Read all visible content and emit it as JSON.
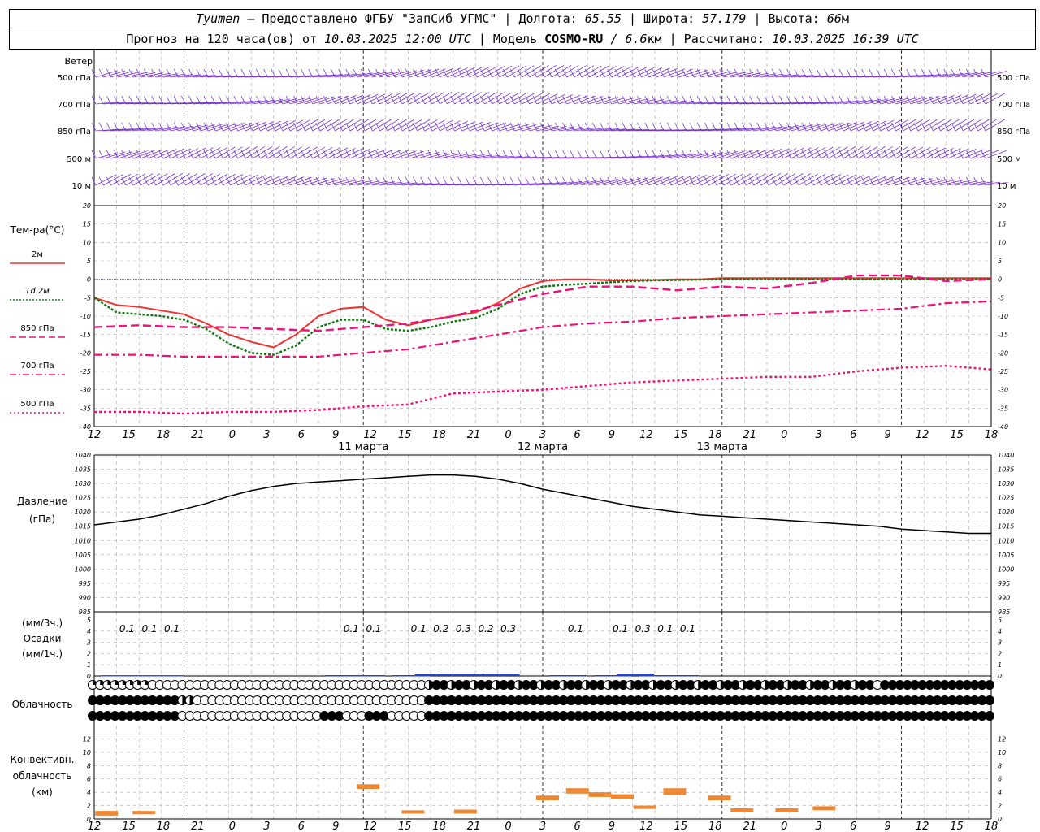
{
  "header": {
    "line1": {
      "station": "Tyumen",
      "provider": "– Предоставлено ФГБУ \"ЗапСиб УГМС\" | Долгота:",
      "lon": "65.55",
      "sep_lat": "| Широта:",
      "lat": "57.179",
      "sep_alt": "| Высота:",
      "alt": "66",
      "alt_unit": "м"
    },
    "line2": {
      "prefix": "Прогноз на 120 часа(ов) от",
      "start": "10.03.2025 12:00 UTC",
      "model_label": "| Модель",
      "model": "COSMO-RU",
      "res": "/ 6.6",
      "res_unit": "км",
      "calc_label": "| Рассчитано:",
      "calc": "10.03.2025 16:39 UTC"
    }
  },
  "wind": {
    "title": "Ветер",
    "levels": [
      "500 гПа",
      "700 гПа",
      "850 гПа",
      "500 м",
      "10 м"
    ]
  },
  "temperature": {
    "title": "Тем-ра(°С)",
    "legend": [
      {
        "label": "2м",
        "color": "#ee3333",
        "style": "solid"
      },
      {
        "label": "Td 2м",
        "color": "#117711",
        "style": "dotted"
      },
      {
        "label": "850 гПа",
        "color": "#ee1177",
        "style": "dashed"
      },
      {
        "label": "700 гПа",
        "color": "#ee1177",
        "style": "dashdot"
      },
      {
        "label": "500 гПа",
        "color": "#ee1177",
        "style": "dotted"
      }
    ],
    "y_ticks": [
      "20",
      "15",
      "10",
      "5",
      "0",
      "-5",
      "-10",
      "-15",
      "-20",
      "-25",
      "-30",
      "-35",
      "-40"
    ]
  },
  "time_axis": {
    "hour_labels": [
      "12",
      "15",
      "18",
      "21",
      "0",
      "3",
      "6",
      "9",
      "12",
      "15",
      "18",
      "21",
      "0",
      "3",
      "6",
      "9",
      "12",
      "15",
      "18",
      "21",
      "0",
      "3",
      "6",
      "9",
      "12",
      "15",
      "18"
    ],
    "days": [
      {
        "label": "11 марта"
      },
      {
        "label": "12 марта"
      },
      {
        "label": "13 марта"
      }
    ]
  },
  "pressure": {
    "title": "Давление",
    "unit": "(гПа)",
    "y_ticks": [
      "1040",
      "1035",
      "1030",
      "1025",
      "1020",
      "1015",
      "1010",
      "1005",
      "1000",
      "995",
      "990",
      "985"
    ]
  },
  "precipitation": {
    "title": "Осадки",
    "unit_3h": "(мм/3ч.)",
    "unit_1h": "(мм/1ч.)",
    "y_ticks": [
      "5",
      "4",
      "3",
      "2",
      "1",
      "0"
    ],
    "labels": [
      "0.1",
      "0.1",
      "0.1",
      "0.1",
      "0.1",
      "0.1",
      "0.2",
      "0.3",
      "0.2",
      "0.3",
      "0.1",
      "0.1",
      "0.3",
      "0.1",
      "0.1"
    ]
  },
  "cloud": {
    "title": "Облачность"
  },
  "convective": {
    "title_line1": "Конвективн.",
    "title_line2": "облачность",
    "unit": "(км)",
    "y_ticks": [
      "12",
      "10",
      "8",
      "6",
      "4",
      "2",
      "0"
    ]
  },
  "chart_data": {
    "type": "line",
    "x_unit": "hours since 10.03.2025 12:00 UTC",
    "temperature": {
      "ylim": [
        -40,
        20
      ],
      "series": [
        {
          "name": "2м",
          "color": "#ee3333",
          "x": [
            0,
            3,
            6,
            9,
            12,
            15,
            18,
            21,
            24,
            27,
            30,
            33,
            36,
            39,
            42,
            45,
            48,
            51,
            54,
            57,
            60,
            63,
            66,
            69,
            72,
            75,
            78,
            81,
            84,
            87,
            90,
            93,
            96,
            99,
            102,
            105,
            108,
            111,
            114,
            117,
            120
          ],
          "y": [
            -5,
            -7,
            -7.5,
            -8.5,
            -9.5,
            -12,
            -15,
            -17,
            -18.5,
            -15,
            -10,
            -8,
            -7.5,
            -11,
            -12.5,
            -11,
            -10,
            -9,
            -6.5,
            -2.5,
            -0.5,
            0,
            0,
            -0.3,
            -0.3,
            -0.2,
            0,
            0,
            0.3,
            0.3,
            0.3,
            0.3,
            0.3,
            0.3,
            0.3,
            0.3,
            0.3,
            0.3,
            0.3,
            0.3,
            0.3
          ]
        },
        {
          "name": "Td 2м",
          "color": "#117711",
          "x": [
            0,
            3,
            6,
            9,
            12,
            15,
            18,
            21,
            24,
            27,
            30,
            33,
            36,
            39,
            42,
            45,
            48,
            51,
            54,
            57,
            60,
            63,
            66,
            69,
            72,
            75,
            78,
            81,
            84,
            87,
            90,
            93,
            96,
            99,
            102,
            105,
            108,
            111,
            114,
            117,
            120
          ],
          "y": [
            -5,
            -9,
            -9.5,
            -10,
            -11,
            -13.5,
            -17.5,
            -20,
            -20.5,
            -18,
            -13,
            -11,
            -11,
            -13.5,
            -14,
            -13,
            -11.5,
            -10.5,
            -8,
            -4,
            -2,
            -1.5,
            -1.2,
            -0.8,
            -0.5,
            -0.3,
            -0.2,
            -0.1,
            0,
            0,
            0,
            0,
            0,
            0,
            0,
            0,
            0,
            0,
            0,
            0,
            0
          ]
        },
        {
          "name": "850 гПа",
          "color": "#ee1177",
          "x": [
            0,
            6,
            12,
            18,
            24,
            30,
            36,
            42,
            48,
            54,
            60,
            66,
            72,
            78,
            84,
            90,
            96,
            102,
            108,
            114,
            120
          ],
          "y": [
            -13,
            -12.5,
            -13,
            -13,
            -13.5,
            -14,
            -13,
            -12,
            -10,
            -7,
            -4,
            -2,
            -2,
            -3,
            -2,
            -2.5,
            -1,
            1,
            1,
            -0.5,
            0
          ]
        },
        {
          "name": "700 гПа",
          "color": "#ee1177",
          "x": [
            0,
            6,
            12,
            18,
            24,
            30,
            36,
            42,
            48,
            54,
            60,
            66,
            72,
            78,
            84,
            90,
            96,
            102,
            108,
            114,
            120
          ],
          "y": [
            -20.5,
            -20.5,
            -21,
            -21,
            -21,
            -21,
            -20,
            -19,
            -17,
            -15,
            -13,
            -12,
            -11.5,
            -10.5,
            -10,
            -9.5,
            -9,
            -8.5,
            -8,
            -6.5,
            -6
          ]
        },
        {
          "name": "500 гПа",
          "color": "#ee1177",
          "x": [
            0,
            6,
            12,
            18,
            24,
            30,
            36,
            42,
            48,
            54,
            60,
            66,
            72,
            78,
            84,
            90,
            96,
            102,
            108,
            114,
            120
          ],
          "y": [
            -36,
            -36,
            -36.5,
            -36,
            -36,
            -35.5,
            -34.5,
            -34,
            -31,
            -30.5,
            -30,
            -29,
            -28,
            -27.5,
            -27,
            -26.5,
            -26.5,
            -25,
            -24,
            -23.5,
            -24.5
          ]
        }
      ]
    },
    "pressure": {
      "ylim": [
        985,
        1040
      ],
      "series": [
        {
          "name": "Давление",
          "x": [
            0,
            3,
            6,
            9,
            12,
            15,
            18,
            21,
            24,
            27,
            30,
            33,
            36,
            39,
            42,
            45,
            48,
            51,
            54,
            57,
            60,
            63,
            66,
            69,
            72,
            75,
            78,
            81,
            84,
            87,
            90,
            93,
            96,
            99,
            102,
            105,
            108,
            111,
            114,
            117,
            120
          ],
          "y": [
            1015.5,
            1016.5,
            1017.5,
            1019,
            1021,
            1023,
            1025.5,
            1027.5,
            1029,
            1030,
            1030.5,
            1031,
            1031.5,
            1032,
            1032.5,
            1033,
            1033,
            1032.5,
            1031.5,
            1030,
            1028,
            1026.5,
            1025,
            1023.5,
            1022,
            1021,
            1020,
            1019,
            1018.5,
            1018,
            1017.5,
            1017,
            1016.5,
            1016,
            1015.5,
            1015,
            1014,
            1013.5,
            1013,
            1012.5,
            1012.5
          ]
        }
      ]
    },
    "precipitation": {
      "ylim": [
        0,
        5
      ],
      "label_x": [
        2,
        5,
        8,
        32,
        35,
        41,
        44,
        47,
        50,
        53,
        62,
        68,
        71,
        74,
        77
      ],
      "values_3h": [
        0.1,
        0.1,
        0.1,
        0.1,
        0.1,
        0.1,
        0.2,
        0.3,
        0.2,
        0.3,
        0.1,
        0.1,
        0.3,
        0.1,
        0.1
      ]
    },
    "convective_cloud_km": {
      "ylim": [
        0,
        12
      ],
      "bars": [
        {
          "x": 1,
          "base": 0.5,
          "top": 1.2
        },
        {
          "x": 6,
          "base": 0.7,
          "top": 1.2
        },
        {
          "x": 36,
          "base": 4.5,
          "top": 5.2
        },
        {
          "x": 42,
          "base": 0.8,
          "top": 1.3
        },
        {
          "x": 49,
          "base": 0.8,
          "top": 1.4
        },
        {
          "x": 60,
          "base": 2.8,
          "top": 3.5
        },
        {
          "x": 64,
          "base": 3.8,
          "top": 4.6
        },
        {
          "x": 67,
          "base": 3.3,
          "top": 4.0
        },
        {
          "x": 70,
          "base": 3.0,
          "top": 3.7
        },
        {
          "x": 73,
          "base": 1.5,
          "top": 2.0
        },
        {
          "x": 77,
          "base": 3.6,
          "top": 4.6
        },
        {
          "x": 83,
          "base": 2.8,
          "top": 3.5
        },
        {
          "x": 86,
          "base": 1.0,
          "top": 1.6
        },
        {
          "x": 92,
          "base": 1.0,
          "top": 1.6
        },
        {
          "x": 97,
          "base": 1.3,
          "top": 1.9
        }
      ]
    }
  }
}
